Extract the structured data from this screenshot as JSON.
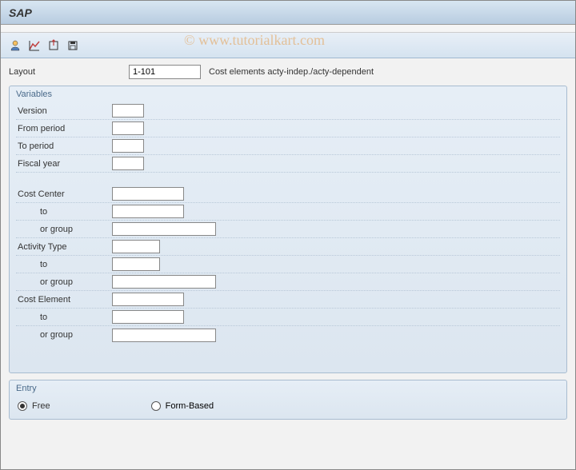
{
  "title": "SAP",
  "watermark": "© www.tutorialkart.com",
  "layout": {
    "label": "Layout",
    "value": "1-101",
    "description": "Cost elements acty-indep./acty-dependent"
  },
  "variables": {
    "title": "Variables",
    "fields": {
      "version_label": "Version",
      "from_period_label": "From period",
      "to_period_label": "To period",
      "fiscal_year_label": "Fiscal year",
      "cost_center_label": "Cost Center",
      "cost_center_to_label": "to",
      "cost_center_group_label": "or group",
      "activity_type_label": "Activity Type",
      "activity_type_to_label": "to",
      "activity_type_group_label": "or group",
      "cost_element_label": "Cost Element",
      "cost_element_to_label": "to",
      "cost_element_group_label": "or group"
    }
  },
  "entry": {
    "title": "Entry",
    "free_label": "Free",
    "form_based_label": "Form-Based",
    "selected": "free"
  }
}
